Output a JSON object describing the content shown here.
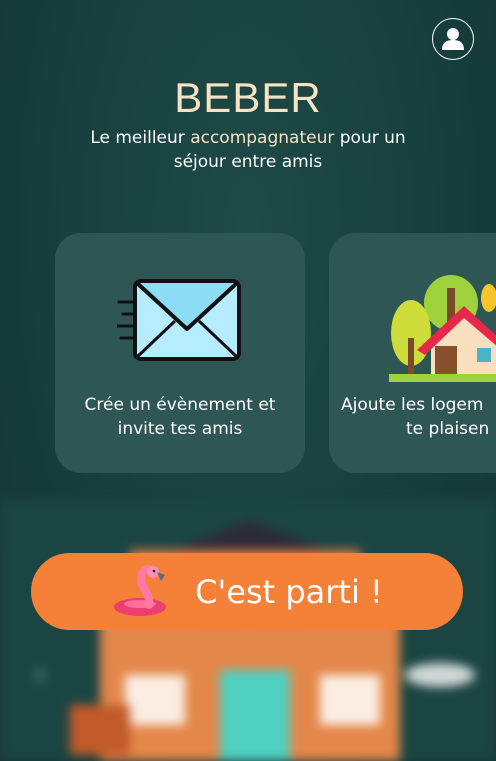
{
  "app": {
    "title": "BEBER",
    "tagline_start": "Le meilleur ",
    "tagline_accent": "accompagnateur",
    "tagline_end": " pour un séjour entre amis"
  },
  "colors": {
    "background": "#173f3d",
    "card": "#2d5655",
    "accent_text": "#f6e3c5",
    "cta": "#f58038"
  },
  "cards": [
    {
      "icon": "envelope-icon",
      "line1": "Crée un évènement et",
      "line2": "invite tes amis"
    },
    {
      "icon": "house-trees-icon",
      "line1": "Ajoute les logem",
      "line2": "te plaisen"
    }
  ],
  "cta": {
    "icon": "flamingo-float-icon",
    "label": "C'est parti !"
  },
  "profile": {
    "icon": "user-icon"
  }
}
